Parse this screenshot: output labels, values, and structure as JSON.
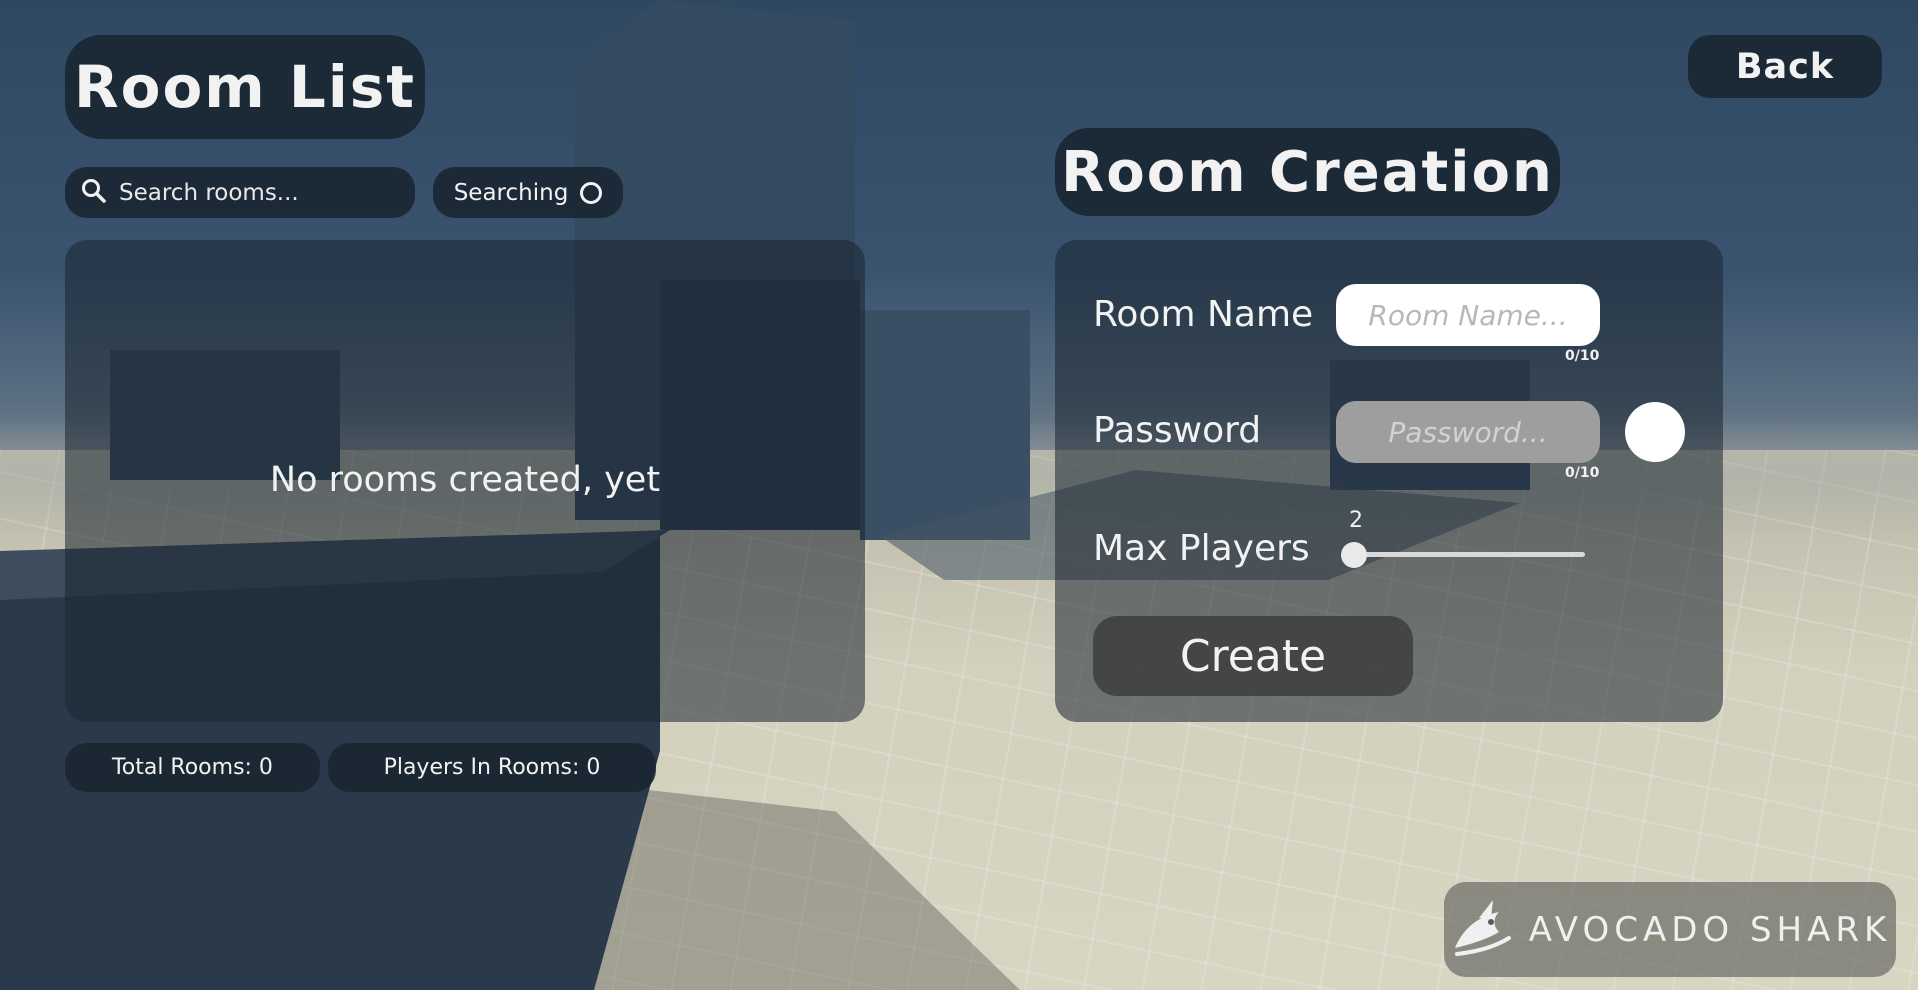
{
  "room_list": {
    "title": "Room List",
    "search_placeholder": "Search rooms...",
    "searching_label": "Searching",
    "empty_message": "No rooms created, yet",
    "total_rooms": "Total Rooms: 0",
    "players_in_rooms": "Players In Rooms: 0"
  },
  "header": {
    "back_label": "Back"
  },
  "room_creation": {
    "title": "Room Creation",
    "room_name_label": "Room Name",
    "room_name_placeholder": "Room Name...",
    "room_name_count": "0/10",
    "password_label": "Password",
    "password_placeholder": "Password...",
    "password_count": "0/10",
    "max_players_label": "Max Players",
    "max_players_value": "2",
    "create_label": "Create"
  },
  "branding": {
    "logo_text": "AVOCADO SHARK"
  },
  "icons": {
    "search": "search-icon",
    "spinner": "loading-spinner-icon",
    "logo": "shark-logo-icon"
  }
}
